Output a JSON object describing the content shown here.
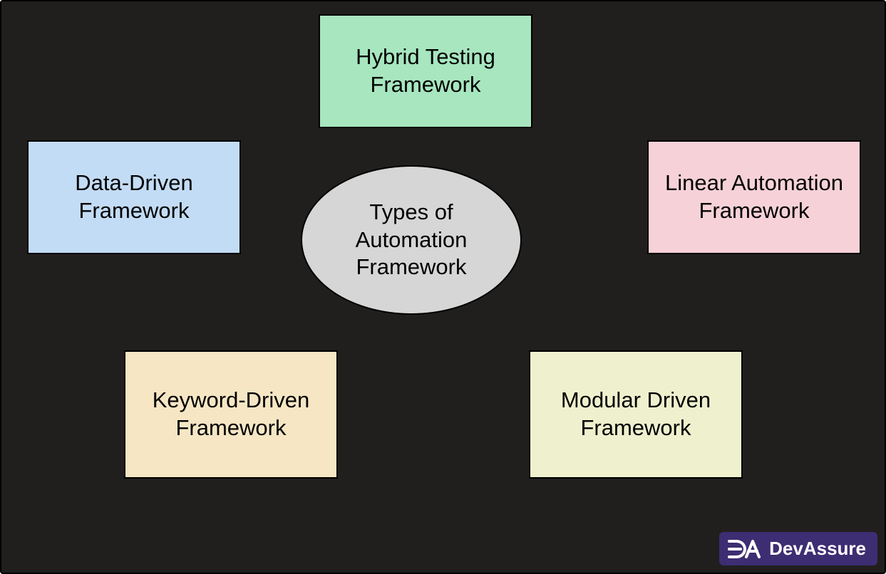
{
  "center": {
    "label": "Types of Automation Framework",
    "color": "#d6d6d6"
  },
  "nodes": {
    "hybrid": {
      "label": "Hybrid Testing Framework",
      "color": "#a7e6bf"
    },
    "dataDriven": {
      "label": "Data-Driven Framework",
      "color": "#c3dcf5"
    },
    "linear": {
      "label": "Linear Automation Framework",
      "color": "#f6d2d8"
    },
    "keyword": {
      "label": "Keyword-Driven Framework",
      "color": "#f6e6c4"
    },
    "modular": {
      "label": "Modular Driven Framework",
      "color": "#eff1ce"
    }
  },
  "watermark": {
    "brand": "DevAssure",
    "logoText": "DA",
    "bg": "#3d2d72"
  }
}
